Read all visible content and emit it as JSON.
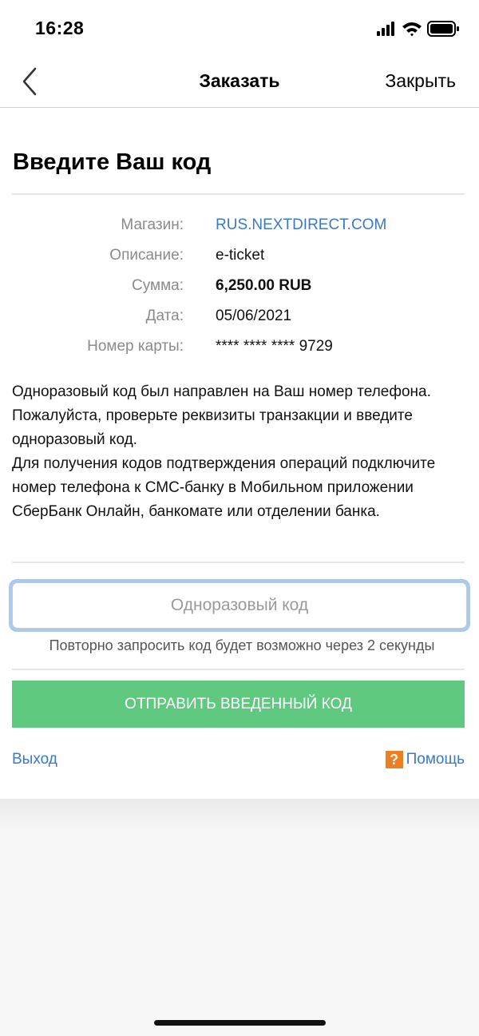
{
  "status_bar": {
    "time": "16:28"
  },
  "nav": {
    "back_icon": "chevron-left-icon",
    "title": "Заказать",
    "close_label": "Закрыть"
  },
  "page": {
    "title": "Введите Ваш код"
  },
  "details": [
    {
      "label": "Магазин:",
      "value": "RUS.NEXTDIRECT.COM"
    },
    {
      "label": "Описание:",
      "value": "e-ticket"
    },
    {
      "label": "Сумма:",
      "value": "6,250.00 RUB"
    },
    {
      "label": "Дата:",
      "value": "05/06/2021"
    },
    {
      "label": "Номер карты:",
      "value": "**** **** **** 9729"
    }
  ],
  "info": {
    "paragraph_1": "Одноразовый код был направлен на Ваш номер телефона. Пожалуйста, проверьте реквизиты транзакции и введите одноразовый код.",
    "paragraph_2": "Для получения кодов подтверждения операций подключите номер телефона к СМС-банку в Мобильном приложении СберБанк Онлайн, банкомате или отделении банка."
  },
  "code_input": {
    "placeholder": "Одноразовый код",
    "value": ""
  },
  "resend_note": "Повторно запросить код будет возможно через 2 секунды",
  "submit_label": "ОТПРАВИТЬ ВВЕДЕННЫЙ КОД",
  "footer": {
    "exit_label": "Выход",
    "help_icon_glyph": "?",
    "help_label": "Помощь"
  },
  "colors": {
    "link": "#3a78c9",
    "submit_button": "#5fc97f",
    "help_icon": "#ef7d22",
    "input_focus_ring": "#a9c9f1"
  }
}
